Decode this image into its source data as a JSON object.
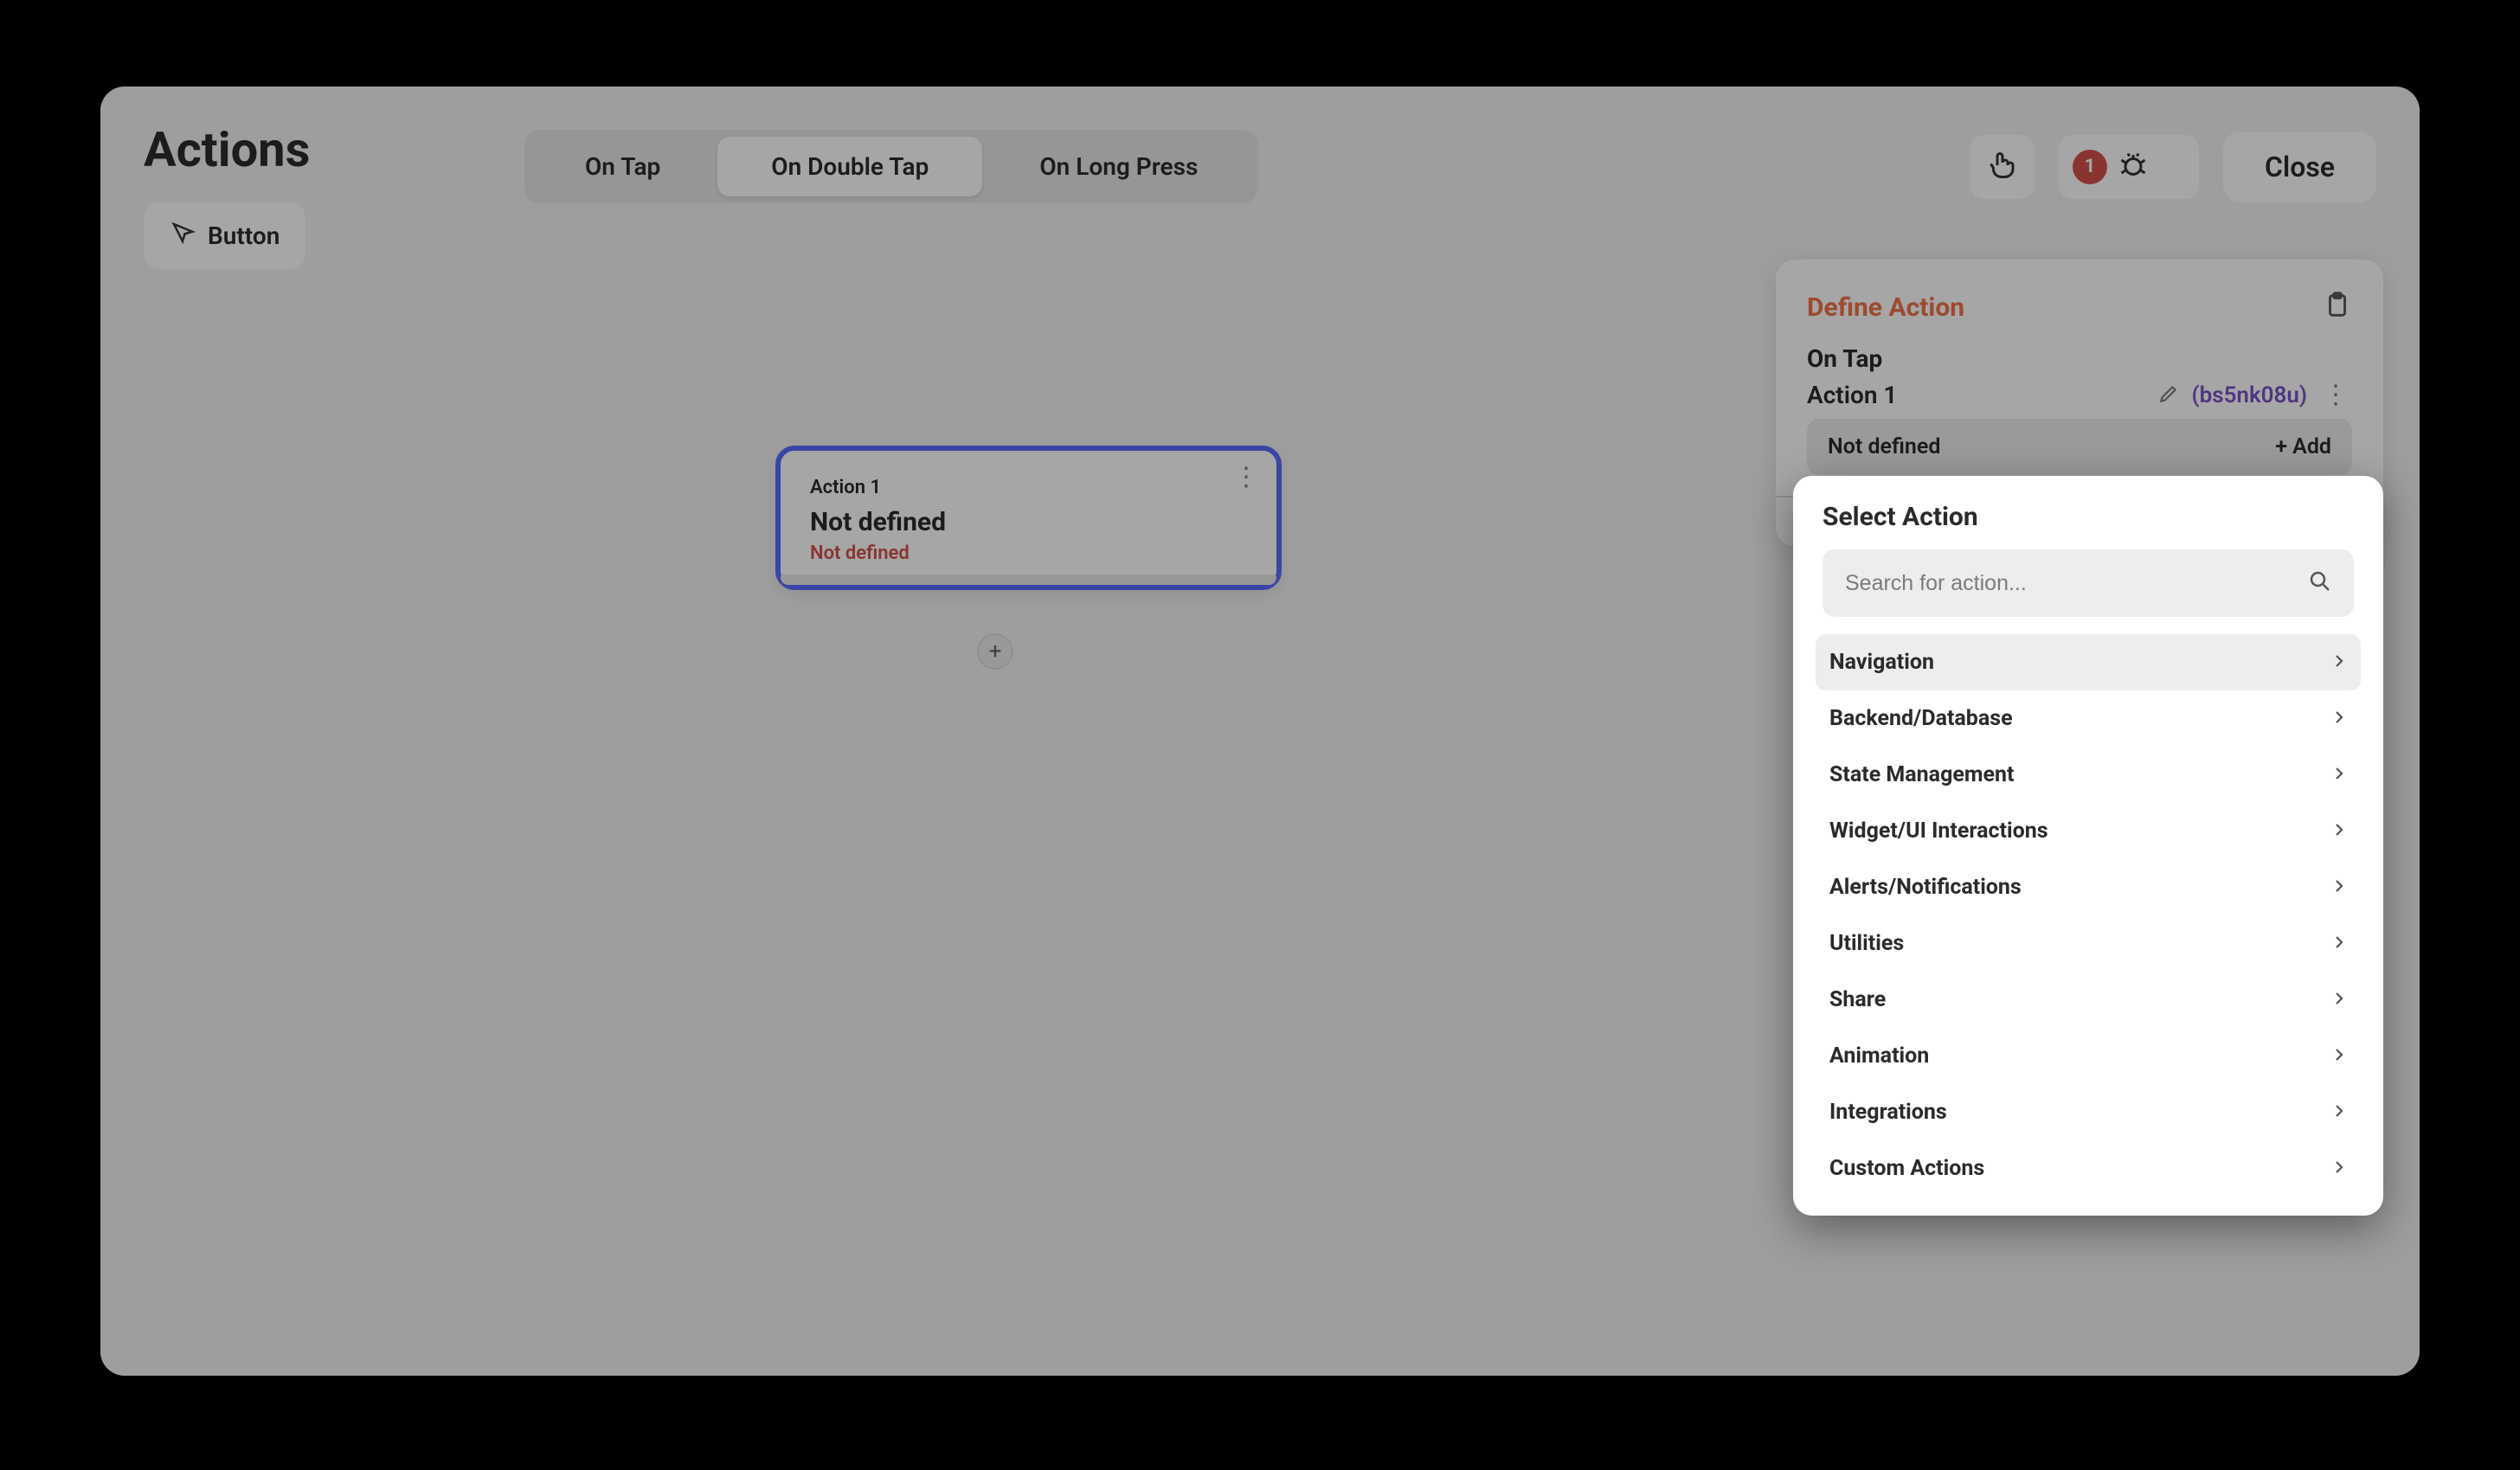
{
  "sidebar": {
    "title": "Actions",
    "widget_label": "Button"
  },
  "topbar": {
    "tabs": [
      "On Tap",
      "On Double Tap",
      "On Long Press"
    ],
    "active_tab_index": 1,
    "error_count": "1",
    "close_label": "Close"
  },
  "canvas": {
    "action_card": {
      "index_label": "Action 1",
      "title": "Not defined",
      "subtitle": "Not defined"
    }
  },
  "panel": {
    "heading": "Define Action",
    "trigger_label": "On Tap",
    "action_name": "Action 1",
    "action_id": "(bs5nk08u)",
    "field_label": "Not defined",
    "field_hint": "+ Add"
  },
  "popover": {
    "heading": "Select Action",
    "search_placeholder": "Search for action...",
    "categories": [
      "Navigation",
      "Backend/Database",
      "State Management",
      "Widget/UI Interactions",
      "Alerts/Notifications",
      "Utilities",
      "Share",
      "Animation",
      "Integrations",
      "Custom Actions"
    ],
    "active_category_index": 0
  }
}
